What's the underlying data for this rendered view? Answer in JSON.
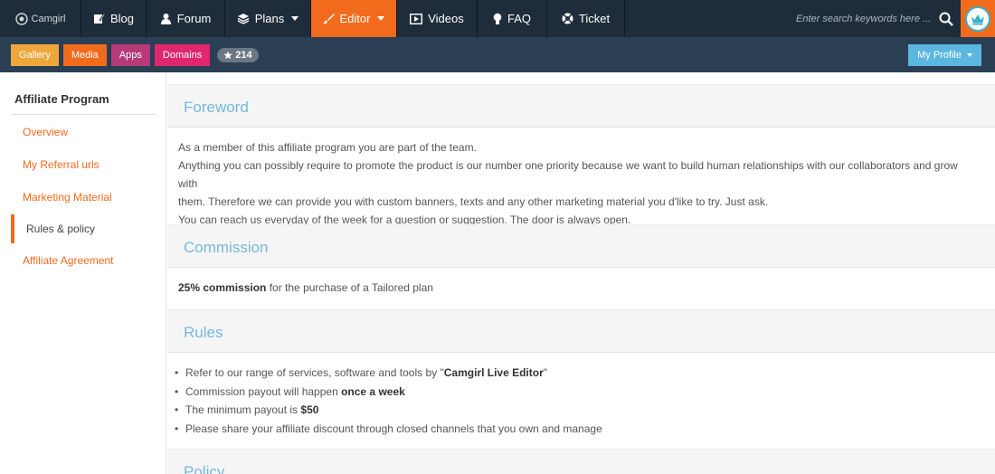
{
  "nav": {
    "brand": "Camgirl",
    "items": [
      {
        "label": "Blog",
        "icon": "edit-icon"
      },
      {
        "label": "Forum",
        "icon": "user-icon"
      },
      {
        "label": "Plans",
        "icon": "layers-icon"
      },
      {
        "label": "Editor",
        "icon": "brush-icon"
      },
      {
        "label": "Videos",
        "icon": "play-icon"
      },
      {
        "label": "FAQ",
        "icon": "bulb-icon"
      },
      {
        "label": "Ticket",
        "icon": "lifebuoy-icon"
      }
    ],
    "search_placeholder": "Enter search keywords here ...",
    "active_color": "#f26b1d"
  },
  "subnav": {
    "pills": [
      "Gallery",
      "Media",
      "Apps",
      "Domains"
    ],
    "star_count": "214",
    "profile_label": "My Profile"
  },
  "sidebar": {
    "title": "Affiliate Program",
    "items": [
      "Overview",
      "My Referral urls",
      "Marketing Material",
      "Rules & policy",
      "Affiliate Agreement"
    ],
    "active_index": 3
  },
  "main": {
    "foreword": {
      "heading": "Foreword",
      "lines": [
        "As a member of this affiliate program you are part of the team.",
        "Anything you can possibly require to promote the product is our number one priority because we want to build human relationships with our collaborators and grow with",
        "them. Therefore we can provide you with custom banners, texts and any other marketing material you d'like to try. Just ask.",
        "You can reach us everyday of the week for a question or suggestion. The door is always open."
      ]
    },
    "commission": {
      "heading": "Commission",
      "bold": "25% commission",
      "rest": " for the purchase of a Tailored plan"
    },
    "rules": {
      "heading": "Rules",
      "b1_pre": "Refer to our range of services, software and tools by \"",
      "b1_bold": "Camgirl Live Editor",
      "b1_post": "\"",
      "b2_pre": "Commission payout will happen ",
      "b2_bold": "once a week",
      "b3_pre": "The minimum payout is ",
      "b3_bold": "$50",
      "b4": "Please share your affiliate discount through closed channels that you own and manage"
    },
    "policy": {
      "heading": "Policy"
    }
  }
}
